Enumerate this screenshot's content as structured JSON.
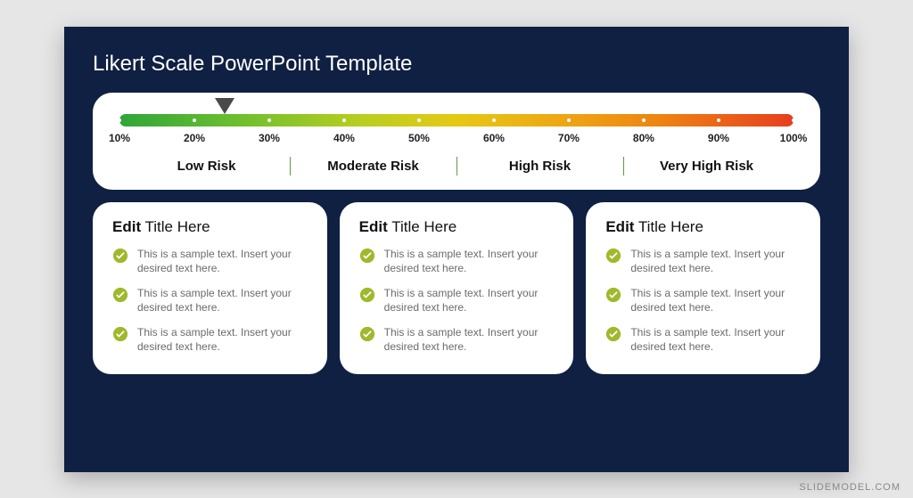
{
  "title": "Likert Scale PowerPoint Template",
  "scale": {
    "ticks": [
      "10%",
      "20%",
      "30%",
      "40%",
      "50%",
      "60%",
      "70%",
      "80%",
      "90%",
      "100%"
    ],
    "marker_percent": 24,
    "risk_labels": [
      "Low Risk",
      "Moderate Risk",
      "High Risk",
      "Very High Risk"
    ]
  },
  "cards": [
    {
      "title_bold": "Edit",
      "title_rest": " Title Here",
      "bullets": [
        "This is a sample text. Insert your desired text here.",
        "This is a sample text. Insert your desired text here.",
        "This is a sample text. Insert your desired text here."
      ]
    },
    {
      "title_bold": "Edit",
      "title_rest": " Title Here",
      "bullets": [
        "This is a sample text. Insert your desired text here.",
        "This is a sample text. Insert your desired text here.",
        "This is a sample text. Insert your desired text here."
      ]
    },
    {
      "title_bold": "Edit",
      "title_rest": " Title Here",
      "bullets": [
        "This is a sample text. Insert your desired text here.",
        "This is a sample text. Insert your desired text here.",
        "This is a sample text. Insert your desired text here."
      ]
    }
  ],
  "watermark": "SLIDEMODEL.COM",
  "colors": {
    "slide_bg": "#0f2042",
    "check_fill": "#9fb92c"
  }
}
